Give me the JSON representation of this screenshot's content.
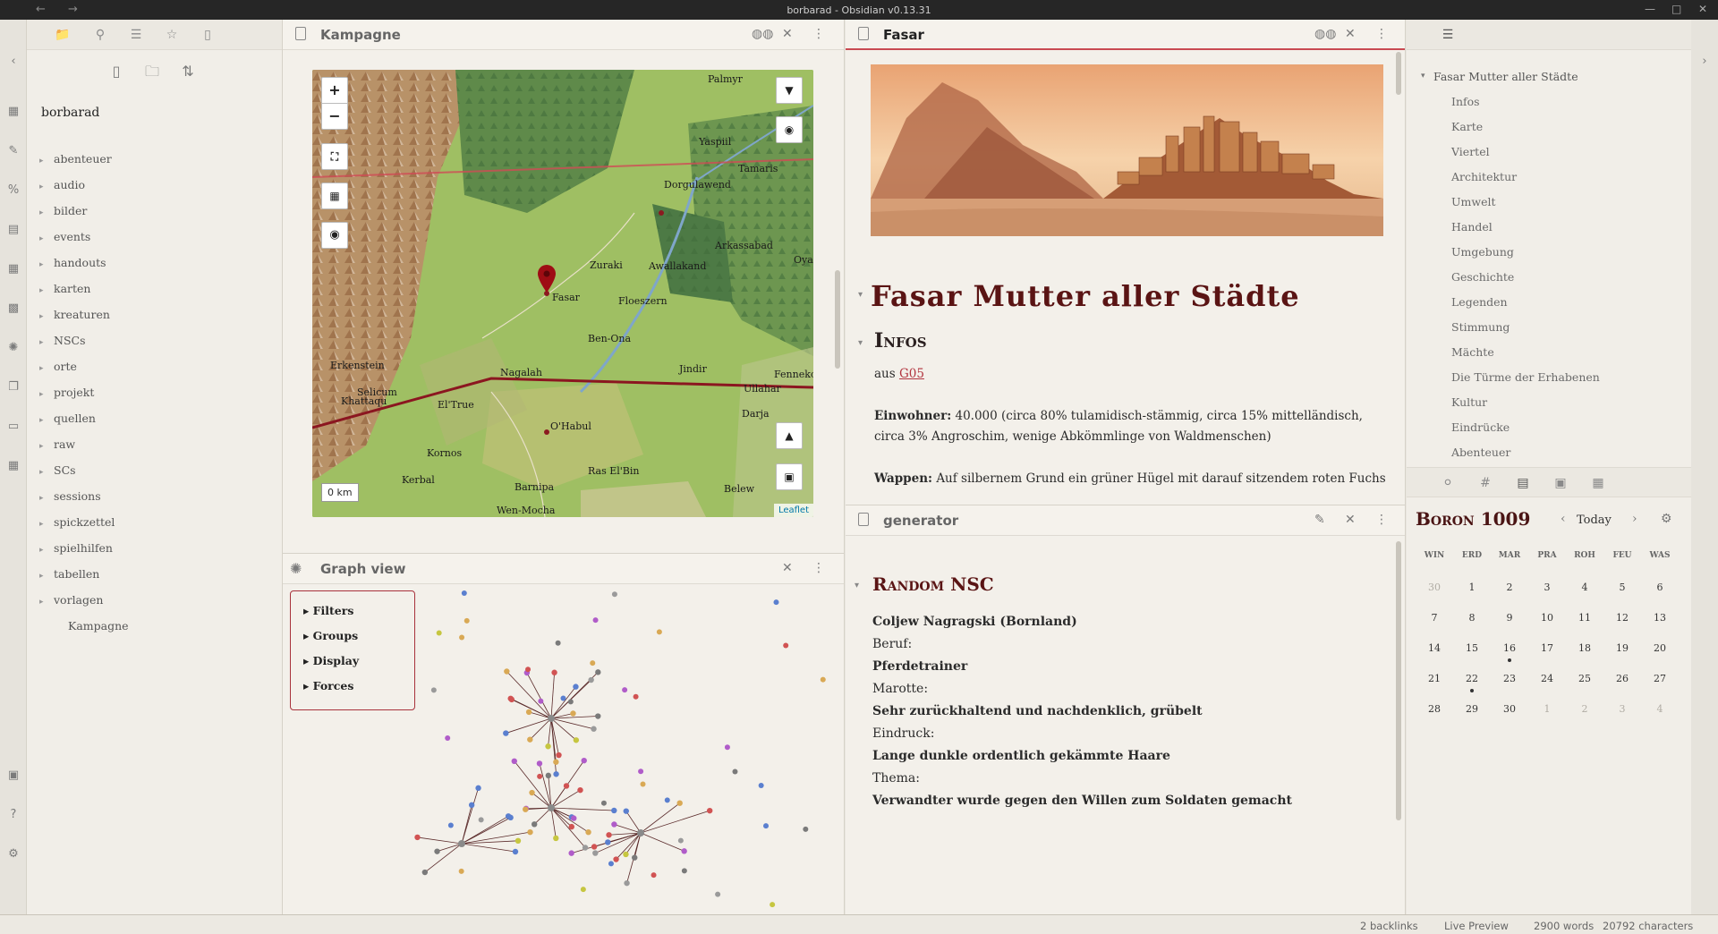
{
  "window": {
    "title": "borbarad - Obsidian v0.13.31"
  },
  "file_explorer": {
    "vault_name": "borbarad",
    "folders": [
      "abenteuer",
      "audio",
      "bilder",
      "events",
      "handouts",
      "karten",
      "kreaturen",
      "NSCs",
      "orte",
      "projekt",
      "quellen",
      "raw",
      "SCs",
      "sessions",
      "spickzettel",
      "spielhilfen",
      "tabellen",
      "vorlagen"
    ],
    "file": "Kampagne"
  },
  "map_pane": {
    "title": "Kampagne",
    "scale": "0 km",
    "attribution": "Leaflet",
    "labels": {
      "palmyr": "Palmyr",
      "yaspiil": "Yaspiil",
      "tamaris": "Tamaris",
      "dorgulawend": "Dorgulawend",
      "arkassabad": "Arkassabad",
      "oyo": "Oya",
      "awallakand": "Awallakand",
      "fasar": "Fasar",
      "floeszern": "Floeszern",
      "benona": "Ben-Ona",
      "jindir": "Jindir",
      "fennek": "Fenneko",
      "ullahar": "Ullahar",
      "erkenstein": "Erkenstein",
      "nagalah": "Nagalah",
      "elhrue": "El'True",
      "khattaqu": "Khattaqu",
      "selicum": "Selicum",
      "ohabul": "O'Habul",
      "darja": "Darja",
      "kornos": "Kornos",
      "kerbal": "Kerbal",
      "barnipa": "Barnipa",
      "raselbin": "Ras El'Bin",
      "belew": "Belew",
      "wenmocha": "Wen-Mocha",
      "zuraki": "Zuraki"
    }
  },
  "graph_pane": {
    "title": "Graph view",
    "controls": [
      "Filters",
      "Groups",
      "Display",
      "Forces"
    ]
  },
  "note_pane": {
    "title": "Fasar",
    "h1": "Fasar Mutter aller Städte",
    "h2": "Infos",
    "aus_prefix": "aus",
    "aus_link": "G05",
    "einwohner_label": "Einwohner:",
    "einwohner_text": "40.000 (circa 80% tulamidisch-stämmig, circa 15% mittelländisch, circa 3% Angroschim, wenige Abkömmlinge von Waldmenschen)",
    "wappen_label": "Wappen:",
    "wappen_text": "Auf silbernem Grund ein grüner Hügel mit darauf sitzendem roten Fuchs"
  },
  "generator_pane": {
    "title": "generator",
    "heading": "Random NSC",
    "lines": [
      {
        "text": "Coljew Nagragski (Bornland)",
        "bold": true
      },
      {
        "text": "Beruf:",
        "bold": false
      },
      {
        "text": "Pferdetrainer",
        "bold": true
      },
      {
        "text": "Marotte:",
        "bold": false
      },
      {
        "text": "Sehr zurückhaltend und nachdenklich, grübelt",
        "bold": true
      },
      {
        "text": "Eindruck:",
        "bold": false
      },
      {
        "text": "Lange dunkle ordentlich gekämmte Haare",
        "bold": true
      },
      {
        "text": "Thema:",
        "bold": false
      },
      {
        "text": "Verwandter wurde gegen den Willen zum Soldaten gemacht",
        "bold": true
      }
    ]
  },
  "outline": {
    "root": "Fasar Mutter aller Städte",
    "items": [
      "Infos",
      "Karte",
      "Viertel",
      "Architektur",
      "Umwelt",
      "Handel",
      "Umgebung",
      "Geschichte",
      "Legenden",
      "Stimmung",
      "Mächte",
      "Die Türme der Erhabenen",
      "Kultur",
      "Eindrücke",
      "Abenteuer"
    ]
  },
  "calendar": {
    "month": "Boron 1009",
    "today_label": "Today",
    "weekdays": [
      "WIN",
      "ERD",
      "MAR",
      "PRA",
      "ROH",
      "FEU",
      "WAS"
    ],
    "weeks": [
      [
        "30",
        "1",
        "2",
        "3",
        "4",
        "5",
        "6"
      ],
      [
        "7",
        "8",
        "9",
        "10",
        "11",
        "12",
        "13"
      ],
      [
        "14",
        "15",
        "16",
        "17",
        "18",
        "19",
        "20"
      ],
      [
        "21",
        "22",
        "23",
        "24",
        "25",
        "26",
        "27"
      ],
      [
        "28",
        "29",
        "30",
        "1",
        "2",
        "3",
        "4"
      ]
    ]
  },
  "status": {
    "backlinks": "2 backlinks",
    "mode": "Live Preview",
    "words": "2900 words",
    "chars": "20792 characters"
  }
}
